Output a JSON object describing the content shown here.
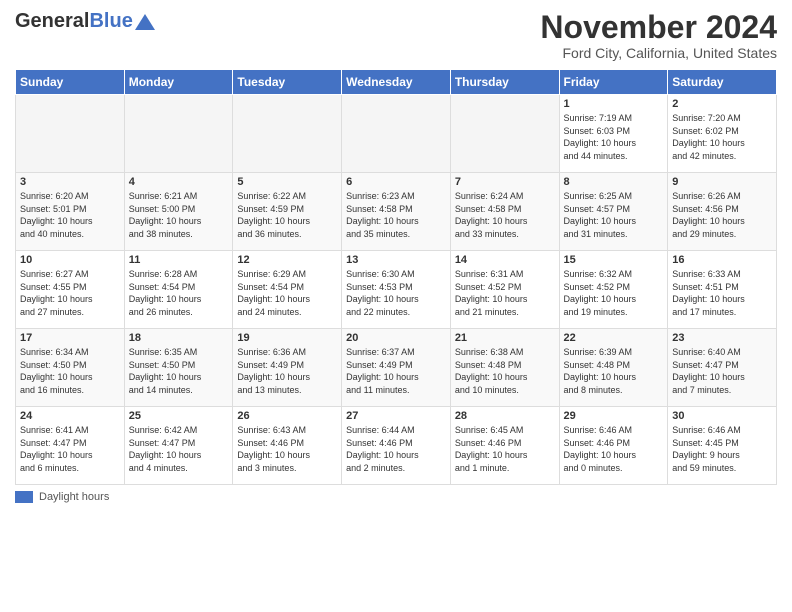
{
  "header": {
    "logo_general": "General",
    "logo_blue": "Blue",
    "title": "November 2024",
    "location": "Ford City, California, United States"
  },
  "days_of_week": [
    "Sunday",
    "Monday",
    "Tuesday",
    "Wednesday",
    "Thursday",
    "Friday",
    "Saturday"
  ],
  "legend": {
    "label": "Daylight hours"
  },
  "weeks": [
    {
      "days": [
        {
          "num": "",
          "info": ""
        },
        {
          "num": "",
          "info": ""
        },
        {
          "num": "",
          "info": ""
        },
        {
          "num": "",
          "info": ""
        },
        {
          "num": "",
          "info": ""
        },
        {
          "num": "1",
          "info": "Sunrise: 7:19 AM\nSunset: 6:03 PM\nDaylight: 10 hours\nand 44 minutes."
        },
        {
          "num": "2",
          "info": "Sunrise: 7:20 AM\nSunset: 6:02 PM\nDaylight: 10 hours\nand 42 minutes."
        }
      ]
    },
    {
      "days": [
        {
          "num": "3",
          "info": "Sunrise: 6:20 AM\nSunset: 5:01 PM\nDaylight: 10 hours\nand 40 minutes."
        },
        {
          "num": "4",
          "info": "Sunrise: 6:21 AM\nSunset: 5:00 PM\nDaylight: 10 hours\nand 38 minutes."
        },
        {
          "num": "5",
          "info": "Sunrise: 6:22 AM\nSunset: 4:59 PM\nDaylight: 10 hours\nand 36 minutes."
        },
        {
          "num": "6",
          "info": "Sunrise: 6:23 AM\nSunset: 4:58 PM\nDaylight: 10 hours\nand 35 minutes."
        },
        {
          "num": "7",
          "info": "Sunrise: 6:24 AM\nSunset: 4:58 PM\nDaylight: 10 hours\nand 33 minutes."
        },
        {
          "num": "8",
          "info": "Sunrise: 6:25 AM\nSunset: 4:57 PM\nDaylight: 10 hours\nand 31 minutes."
        },
        {
          "num": "9",
          "info": "Sunrise: 6:26 AM\nSunset: 4:56 PM\nDaylight: 10 hours\nand 29 minutes."
        }
      ]
    },
    {
      "days": [
        {
          "num": "10",
          "info": "Sunrise: 6:27 AM\nSunset: 4:55 PM\nDaylight: 10 hours\nand 27 minutes."
        },
        {
          "num": "11",
          "info": "Sunrise: 6:28 AM\nSunset: 4:54 PM\nDaylight: 10 hours\nand 26 minutes."
        },
        {
          "num": "12",
          "info": "Sunrise: 6:29 AM\nSunset: 4:54 PM\nDaylight: 10 hours\nand 24 minutes."
        },
        {
          "num": "13",
          "info": "Sunrise: 6:30 AM\nSunset: 4:53 PM\nDaylight: 10 hours\nand 22 minutes."
        },
        {
          "num": "14",
          "info": "Sunrise: 6:31 AM\nSunset: 4:52 PM\nDaylight: 10 hours\nand 21 minutes."
        },
        {
          "num": "15",
          "info": "Sunrise: 6:32 AM\nSunset: 4:52 PM\nDaylight: 10 hours\nand 19 minutes."
        },
        {
          "num": "16",
          "info": "Sunrise: 6:33 AM\nSunset: 4:51 PM\nDaylight: 10 hours\nand 17 minutes."
        }
      ]
    },
    {
      "days": [
        {
          "num": "17",
          "info": "Sunrise: 6:34 AM\nSunset: 4:50 PM\nDaylight: 10 hours\nand 16 minutes."
        },
        {
          "num": "18",
          "info": "Sunrise: 6:35 AM\nSunset: 4:50 PM\nDaylight: 10 hours\nand 14 minutes."
        },
        {
          "num": "19",
          "info": "Sunrise: 6:36 AM\nSunset: 4:49 PM\nDaylight: 10 hours\nand 13 minutes."
        },
        {
          "num": "20",
          "info": "Sunrise: 6:37 AM\nSunset: 4:49 PM\nDaylight: 10 hours\nand 11 minutes."
        },
        {
          "num": "21",
          "info": "Sunrise: 6:38 AM\nSunset: 4:48 PM\nDaylight: 10 hours\nand 10 minutes."
        },
        {
          "num": "22",
          "info": "Sunrise: 6:39 AM\nSunset: 4:48 PM\nDaylight: 10 hours\nand 8 minutes."
        },
        {
          "num": "23",
          "info": "Sunrise: 6:40 AM\nSunset: 4:47 PM\nDaylight: 10 hours\nand 7 minutes."
        }
      ]
    },
    {
      "days": [
        {
          "num": "24",
          "info": "Sunrise: 6:41 AM\nSunset: 4:47 PM\nDaylight: 10 hours\nand 6 minutes."
        },
        {
          "num": "25",
          "info": "Sunrise: 6:42 AM\nSunset: 4:47 PM\nDaylight: 10 hours\nand 4 minutes."
        },
        {
          "num": "26",
          "info": "Sunrise: 6:43 AM\nSunset: 4:46 PM\nDaylight: 10 hours\nand 3 minutes."
        },
        {
          "num": "27",
          "info": "Sunrise: 6:44 AM\nSunset: 4:46 PM\nDaylight: 10 hours\nand 2 minutes."
        },
        {
          "num": "28",
          "info": "Sunrise: 6:45 AM\nSunset: 4:46 PM\nDaylight: 10 hours\nand 1 minute."
        },
        {
          "num": "29",
          "info": "Sunrise: 6:46 AM\nSunset: 4:46 PM\nDaylight: 10 hours\nand 0 minutes."
        },
        {
          "num": "30",
          "info": "Sunrise: 6:46 AM\nSunset: 4:45 PM\nDaylight: 9 hours\nand 59 minutes."
        }
      ]
    }
  ]
}
